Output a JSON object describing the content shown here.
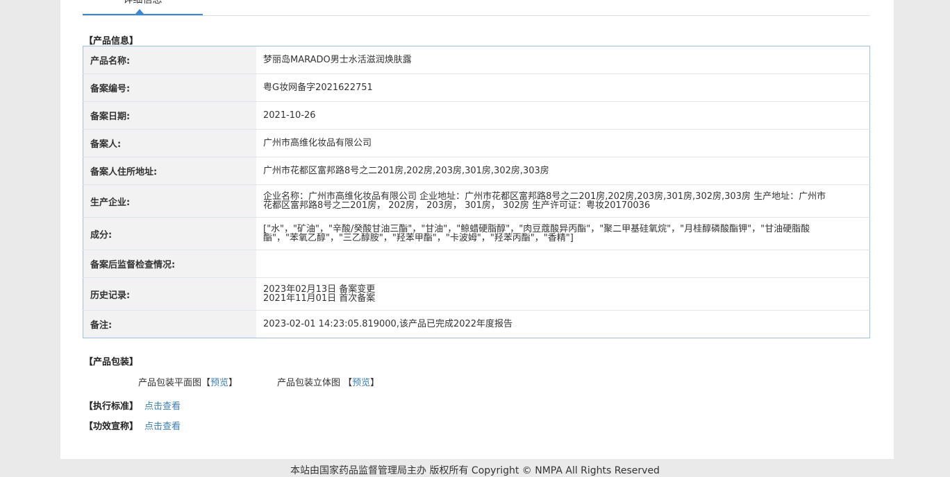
{
  "tab": {
    "label": "详细信息"
  },
  "product_info": {
    "section_title": "【产品信息】",
    "rows": [
      {
        "key": "产品名称:",
        "value": "梦丽岛MARADO男士水活滋润焕肤露"
      },
      {
        "key": "备案编号:",
        "value": "粤G妆网备字2021622751"
      },
      {
        "key": "备案日期:",
        "value": "2021-10-26"
      },
      {
        "key": "备案人:",
        "value": "广州市高维化妆品有限公司"
      },
      {
        "key": "备案人住所地址:",
        "value": "广州市花都区富邦路8号之二201房,202房,203房,301房,302房,303房"
      },
      {
        "key": "生产企业:",
        "value": "企业名称：广州市高维化妆品有限公司 企业地址：广州市花都区富邦路8号之二201房,202房,203房,301房,302房,303房 生产地址：广州市花都区富邦路8号之二201房， 202房， 203房， 301房， 302房 生产许可证：粤妆20170036"
      },
      {
        "key": "成分:",
        "value": "[\"水\"，\"矿油\"，\"辛酸/癸酸甘油三酯\"，\"甘油\"，\"鲸蜡硬脂醇\"，\"肉豆蔻酸异丙酯\"，\"聚二甲基硅氧烷\"，\"月桂醇磷酸酯钾\"，\"甘油硬脂酸酯\"，\"苯氧乙醇\"，\"三乙醇胺\"，\"羟苯甲酯\"，\"卡波姆\"，\"羟苯丙酯\"，\"香精\"]"
      },
      {
        "key": "备案后监督检查情况:",
        "value": ""
      },
      {
        "key": "历史记录:",
        "value_lines": [
          "2023年02月13日 备案变更",
          "2021年11月01日 首次备案"
        ]
      },
      {
        "key": "备注:",
        "value": "2023-02-01 14:23:05.819000,该产品已完成2022年度报告"
      }
    ]
  },
  "packaging": {
    "section_title": "【产品包装】",
    "flat_label": "产品包装平面图【",
    "flat_link": "预览",
    "flat_close": "】",
    "solid_label": "产品包装立体图 【",
    "solid_link": "预览",
    "solid_close": "】"
  },
  "standard": {
    "label": "【执行标准】",
    "link": "点击查看"
  },
  "efficacy": {
    "label": "【功效宣称】",
    "link": "点击查看"
  },
  "footer": {
    "text": "本站由国家药品监督管理局主办 版权所有 Copyright © NMPA All Rights Reserved"
  }
}
